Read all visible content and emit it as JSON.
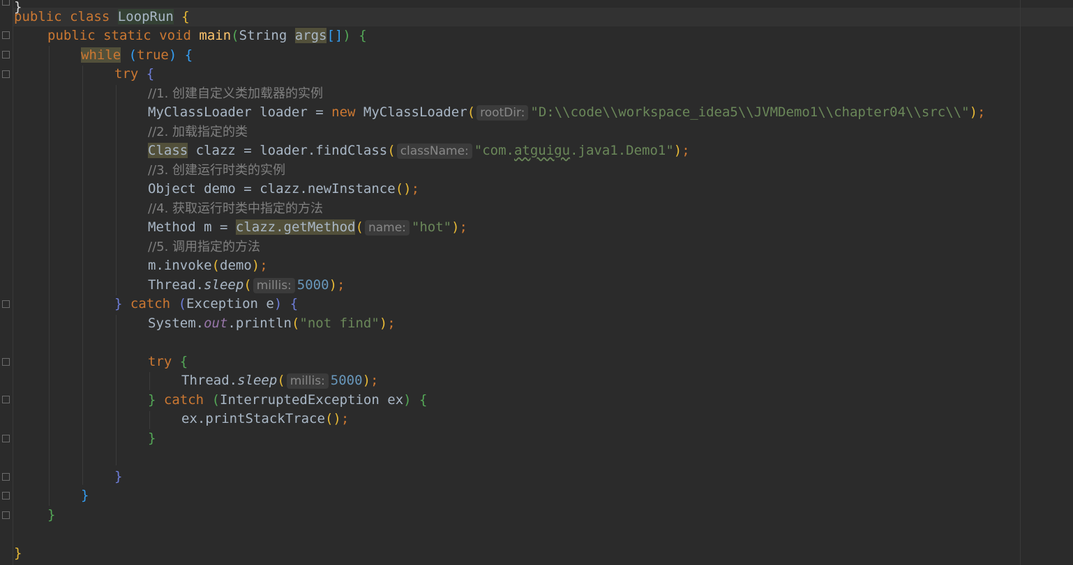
{
  "editor": {
    "lines": [
      {
        "id": "l1",
        "indent": 0
      },
      {
        "id": "l2",
        "indent": 1
      },
      {
        "id": "l3",
        "indent": 2
      },
      {
        "id": "l4",
        "indent": 3
      }
    ],
    "comments": {
      "c1": "//1. 创建自定义类加载器的实例",
      "c2": "//2. 加载指定的类",
      "c3": "//3. 创建运行时类的实例",
      "c4": "//4. 获取运行时类中指定的方法",
      "c5": "//5. 调用指定的方法"
    },
    "hints": {
      "rootDir": "rootDir:",
      "className": "className:",
      "name": "name:",
      "millis1": "millis:",
      "millis2": "millis:"
    },
    "strings": {
      "root_path": "\"D:\\\\code\\\\workspace_idea5\\\\JVMDemo1\\\\chapter04\\\\src\\\\\"",
      "class_pre": "\"com.",
      "class_squig": "atguigu",
      "class_post": ".java1.Demo1\"",
      "method": "\"hot\"",
      "not_find": "\"not find\""
    },
    "numbers": {
      "sleep1": "5000",
      "sleep2": "5000"
    },
    "tokens": {
      "public": "public",
      "class": "class",
      "classname": "LoopRun",
      "static": "static",
      "void": "void",
      "main": "main",
      "string": "String",
      "args": "args",
      "while": "while",
      "true": "true",
      "try": "try",
      "catch": "catch",
      "new": "new",
      "myclassloader": "MyClassLoader",
      "loader": "loader",
      "Class": "Class",
      "clazz": "clazz",
      "findClass": "findClass",
      "Object": "Object",
      "demo": "demo",
      "newInstance": "newInstance",
      "Method": "Method",
      "m": "m",
      "getMethod": "getMethod",
      "invoke": "invoke",
      "Thread": "Thread",
      "sleep": "sleep",
      "Exception": "Exception",
      "e": "e",
      "System": "System",
      "out": "out",
      "println": "println",
      "InterruptedException": "InterruptedException",
      "ex": "ex",
      "printStackTrace": "printStackTrace"
    }
  }
}
